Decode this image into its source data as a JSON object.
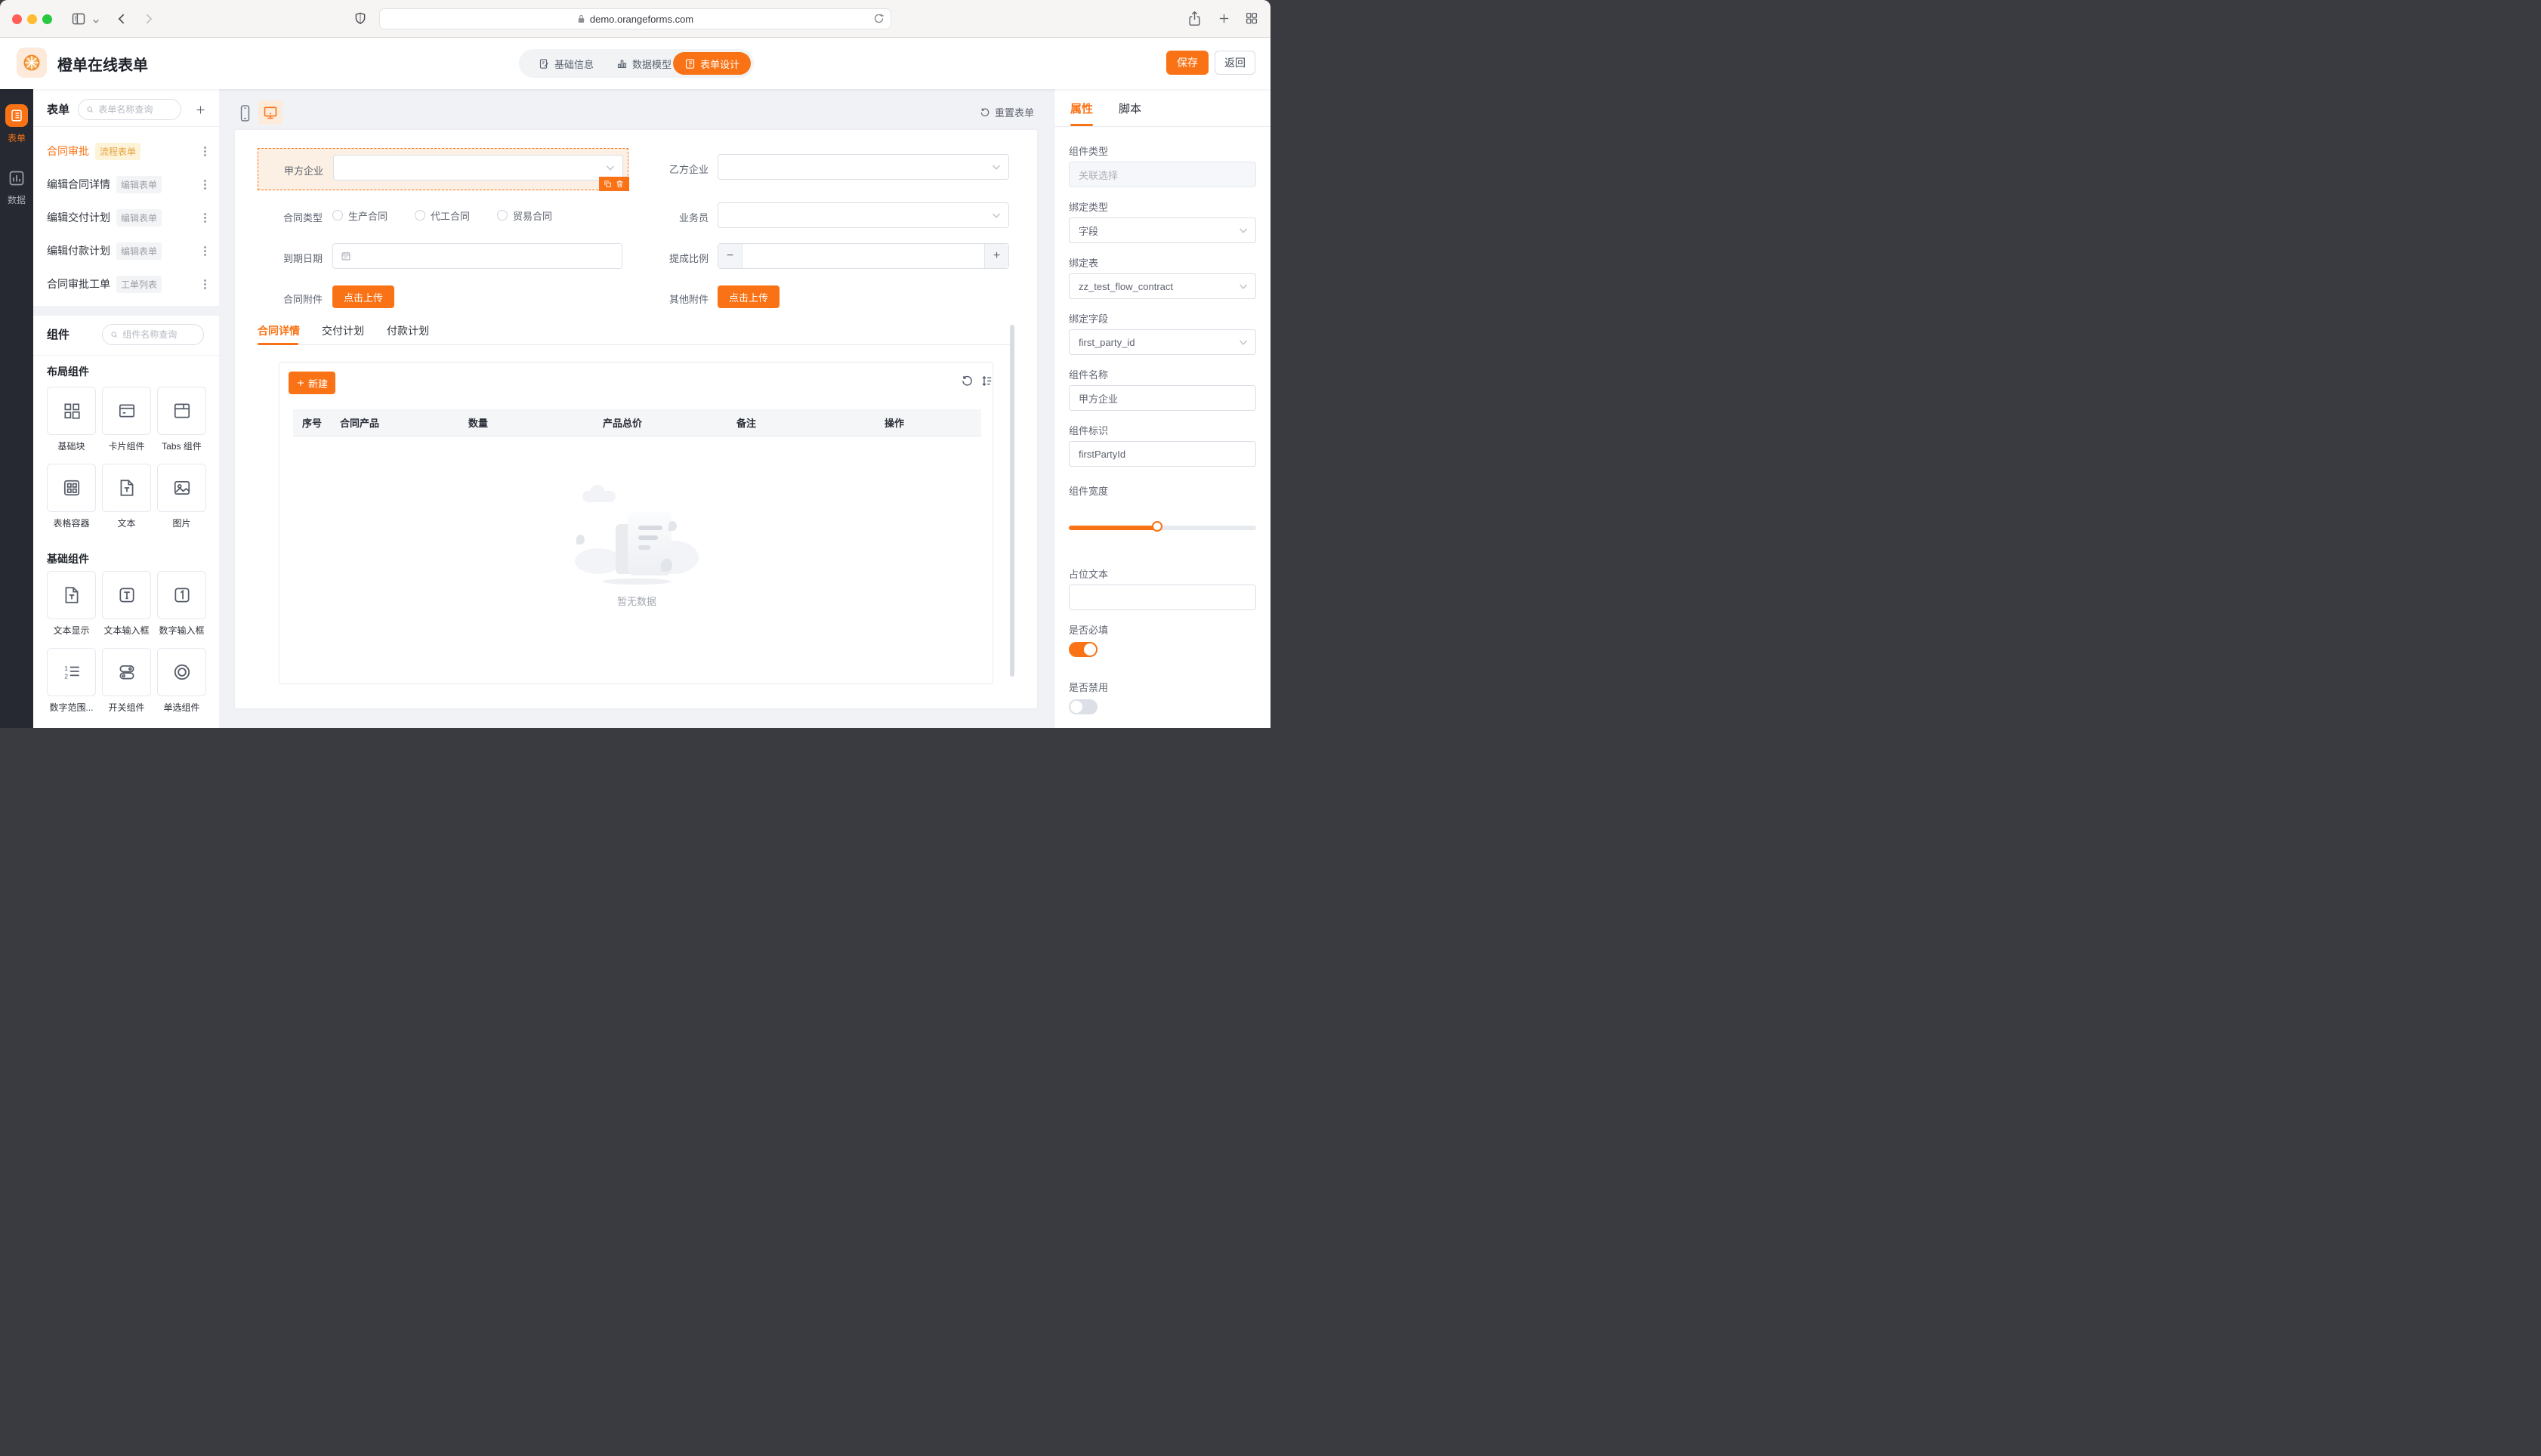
{
  "browser": {
    "url": "demo.orangeforms.com"
  },
  "header": {
    "app_title": "橙单在线表单",
    "nav": {
      "basic_info": "基础信息",
      "data_model": "数据模型",
      "form_design": "表单设计"
    },
    "save": "保存",
    "back": "返回"
  },
  "rail": {
    "form": "表单",
    "data": "数据"
  },
  "forms_panel": {
    "title": "表单",
    "search_placeholder": "表单名称查询",
    "items": [
      {
        "name": "合同审批",
        "badge": "流程表单"
      },
      {
        "name": "编辑合同详情",
        "badge": "编辑表单"
      },
      {
        "name": "编辑交付计划",
        "badge": "编辑表单"
      },
      {
        "name": "编辑付款计划",
        "badge": "编辑表单"
      },
      {
        "name": "合同审批工单",
        "badge": "工单列表"
      }
    ]
  },
  "components_panel": {
    "title": "组件",
    "search_placeholder": "组件名称查询",
    "layout_group": "布局组件",
    "basic_group": "基础组件",
    "layout_tiles": [
      "基础块",
      "卡片组件",
      "Tabs 组件",
      "表格容器",
      "文本",
      "图片"
    ],
    "basic_tiles": [
      "文本显示",
      "文本输入框",
      "数字输入框",
      "数字范围...",
      "开关组件",
      "单选组件"
    ]
  },
  "canvas": {
    "reset": "重置表单",
    "form": {
      "first_party_label": "甲方企业",
      "second_party_label": "乙方企业",
      "contract_type_label": "合同类型",
      "contract_type_options": [
        "生产合同",
        "代工合同",
        "贸易合同"
      ],
      "salesman_label": "业务员",
      "due_date_label": "到期日期",
      "commission_label": "提成比例",
      "contract_attachment_label": "合同附件",
      "other_attachment_label": "其他附件",
      "upload_button": "点击上传"
    },
    "detail_tabs": [
      "合同详情",
      "交付计划",
      "付款计划"
    ],
    "new_button": "新建",
    "table_headers": [
      "序号",
      "合同产品",
      "数量",
      "产品总价",
      "备注",
      "操作"
    ],
    "empty_text": "暂无数据"
  },
  "properties": {
    "tab_attr": "属性",
    "tab_script": "脚本",
    "component_type_label": "组件类型",
    "component_type_value": "关联选择",
    "bind_type_label": "绑定类型",
    "bind_type_value": "字段",
    "bind_table_label": "绑定表",
    "bind_table_value": "zz_test_flow_contract",
    "bind_field_label": "绑定字段",
    "bind_field_value": "first_party_id",
    "name_label": "组件名称",
    "name_value": "甲方企业",
    "key_label": "组件标识",
    "key_value": "firstPartyId",
    "width_label": "组件宽度",
    "width_percent": 48,
    "placeholder_label": "占位文本",
    "placeholder_value": "",
    "required_label": "是否必填",
    "required_on": true,
    "disabled_label": "是否禁用",
    "disabled_on": false
  },
  "colors": {
    "accent": "#F97316",
    "accent_light_bg": "#FCEFE3",
    "flow_badge_bg": "#FDF3D9",
    "flow_badge_text": "#E7A23C"
  }
}
